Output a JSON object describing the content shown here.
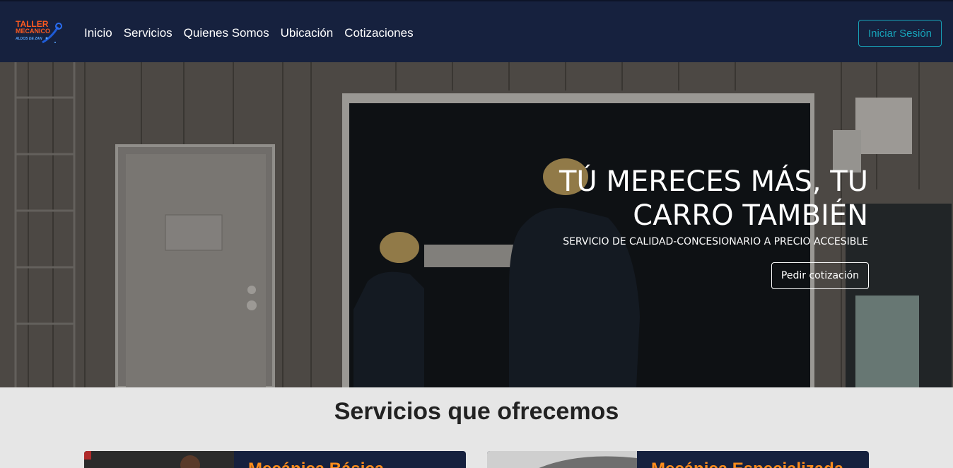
{
  "logo": {
    "line1": "TALLER",
    "line2": "MECANICO",
    "line3": "ALDOS DE ZAN"
  },
  "nav": {
    "items": [
      "Inicio",
      "Servicios",
      "Quienes Somos",
      "Ubicación",
      "Cotizaciones"
    ],
    "login": "Iniciar Sesión"
  },
  "hero": {
    "title": "TÚ MERECES MÁS, TU CARRO TAMBIÉN",
    "subtitle": "SERVICIO DE CALIDAD-CONCESIONARIO A PRECIO ACCESIBLE",
    "button": "Pedir cotización"
  },
  "services": {
    "title": "Servicios que ofrecemos",
    "cards": [
      {
        "title": "Mecánica Básica"
      },
      {
        "title": "Mecánica Especializada"
      }
    ]
  },
  "colors": {
    "navbar": "#16213e",
    "accent": "#17a2b8",
    "card_title": "#ff8c1a",
    "logo": "#ff5a1f"
  }
}
